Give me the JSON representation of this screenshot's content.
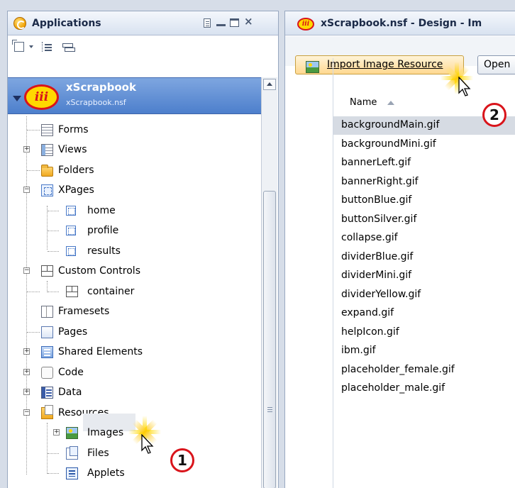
{
  "left_panel": {
    "title": "Applications",
    "icons": [
      "applications-icon",
      "document-icon",
      "minimize-icon",
      "maximize-icon",
      "close-icon",
      "new-application-icon",
      "dropdown-arrow-icon",
      "tree-view-icon",
      "flat-view-icon"
    ],
    "close_glyph": "×",
    "app": {
      "name": "xScrapbook",
      "file": "xScrapbook.nsf",
      "logo_text": "iii"
    },
    "tree": {
      "forms": "Forms",
      "views": "Views",
      "folders": "Folders",
      "xpages": "XPages",
      "xpages_children": [
        "home",
        "profile",
        "results"
      ],
      "custom_controls": "Custom Controls",
      "custom_controls_children": [
        "container"
      ],
      "framesets": "Framesets",
      "pages": "Pages",
      "shared_elements": "Shared Elements",
      "code": "Code",
      "data": "Data",
      "resources": "Resources",
      "images": "Images",
      "files": "Files",
      "applets": "Applets"
    },
    "expander_plus": "+",
    "expander_minus": "−"
  },
  "right_panel": {
    "tab_title": "xScrapbook.nsf - Design - Im",
    "tab_logo_text": "iii",
    "toolbar": {
      "import_label": "Import Image Resource",
      "open_label": "Open"
    },
    "column_name": "Name",
    "files": [
      "backgroundMain.gif",
      "backgroundMini.gif",
      "bannerLeft.gif",
      "bannerRight.gif",
      "buttonBlue.gif",
      "buttonSilver.gif",
      "collapse.gif",
      "dividerBlue.gif",
      "dividerMini.gif",
      "dividerYellow.gif",
      "expand.gif",
      "helpIcon.gif",
      "ibm.gif",
      "placeholder_female.gif",
      "placeholder_male.gif"
    ],
    "selected_file": "backgroundMain.gif"
  },
  "callouts": {
    "step1": "1",
    "step2": "2"
  },
  "colors": {
    "app_header": "#5b8bd4",
    "callout_ring": "#d9141b",
    "logo_yellow": "#ffd800"
  }
}
